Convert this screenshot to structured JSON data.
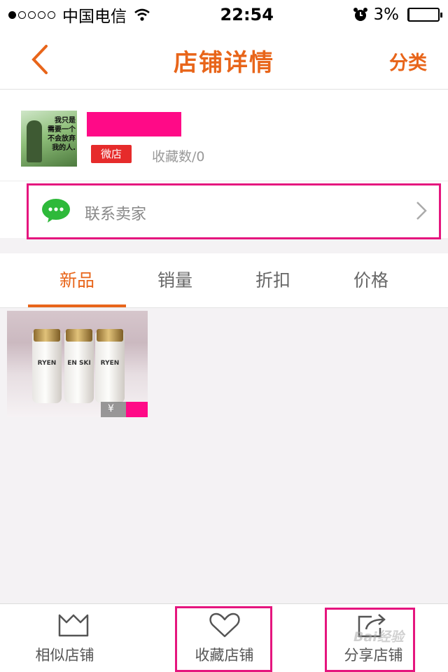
{
  "status_bar": {
    "carrier": "中国电信",
    "time": "22:54",
    "battery": "3%",
    "battery_level": 0.03
  },
  "nav": {
    "back_icon": "chevron-left-icon",
    "title": "店铺详情",
    "right_label": "分类"
  },
  "shop": {
    "avatar_text": [
      "我只是",
      "需要一个",
      "不会放弃",
      "我的人."
    ],
    "badge": "微店",
    "favorites": "收藏数/0",
    "contact_label": "联系卖家"
  },
  "tabs": [
    {
      "label": "新品",
      "active": true
    },
    {
      "label": "销量",
      "active": false
    },
    {
      "label": "折扣",
      "active": false
    },
    {
      "label": "价格",
      "active": false
    }
  ],
  "product": {
    "bottle_labels": [
      "RYEN",
      "EN SKI",
      "RYEN"
    ],
    "currency": "¥"
  },
  "bottom_bar": {
    "similar": "相似店铺",
    "favorite": "收藏店铺",
    "share": "分享店铺"
  },
  "watermark": "Bai经验",
  "colors": {
    "accent": "#e8651a",
    "highlight": "#e5157e",
    "mask": "#ff0a87",
    "badge": "#e62b2b"
  }
}
